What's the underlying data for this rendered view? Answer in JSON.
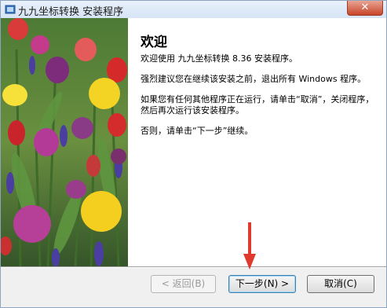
{
  "window": {
    "title": "九九坐标转换 安装程序",
    "close_symbol": "✕"
  },
  "welcome": {
    "heading": "欢迎",
    "paragraphs": [
      "欢迎使用 九九坐标转换 8.36 安装程序。",
      "强烈建议您在继续该安装之前，退出所有 Windows 程序。",
      "如果您有任何其他程序正在运行，请单击“取消”，关闭程序，然后再次运行该安装程序。",
      "否则，请单击“下一步”继续。"
    ]
  },
  "buttons": {
    "back": "< 返回(B)",
    "next": "下一步(N) >",
    "cancel": "取消(C)"
  },
  "colors": {
    "annotation_arrow": "#e03a2f",
    "default_button_border": "#3c7fb1"
  },
  "icons": {
    "app": "installer-icon",
    "close": "close-icon",
    "annotation": "red-arrow-icon",
    "side_banner": "tulip-photo"
  }
}
